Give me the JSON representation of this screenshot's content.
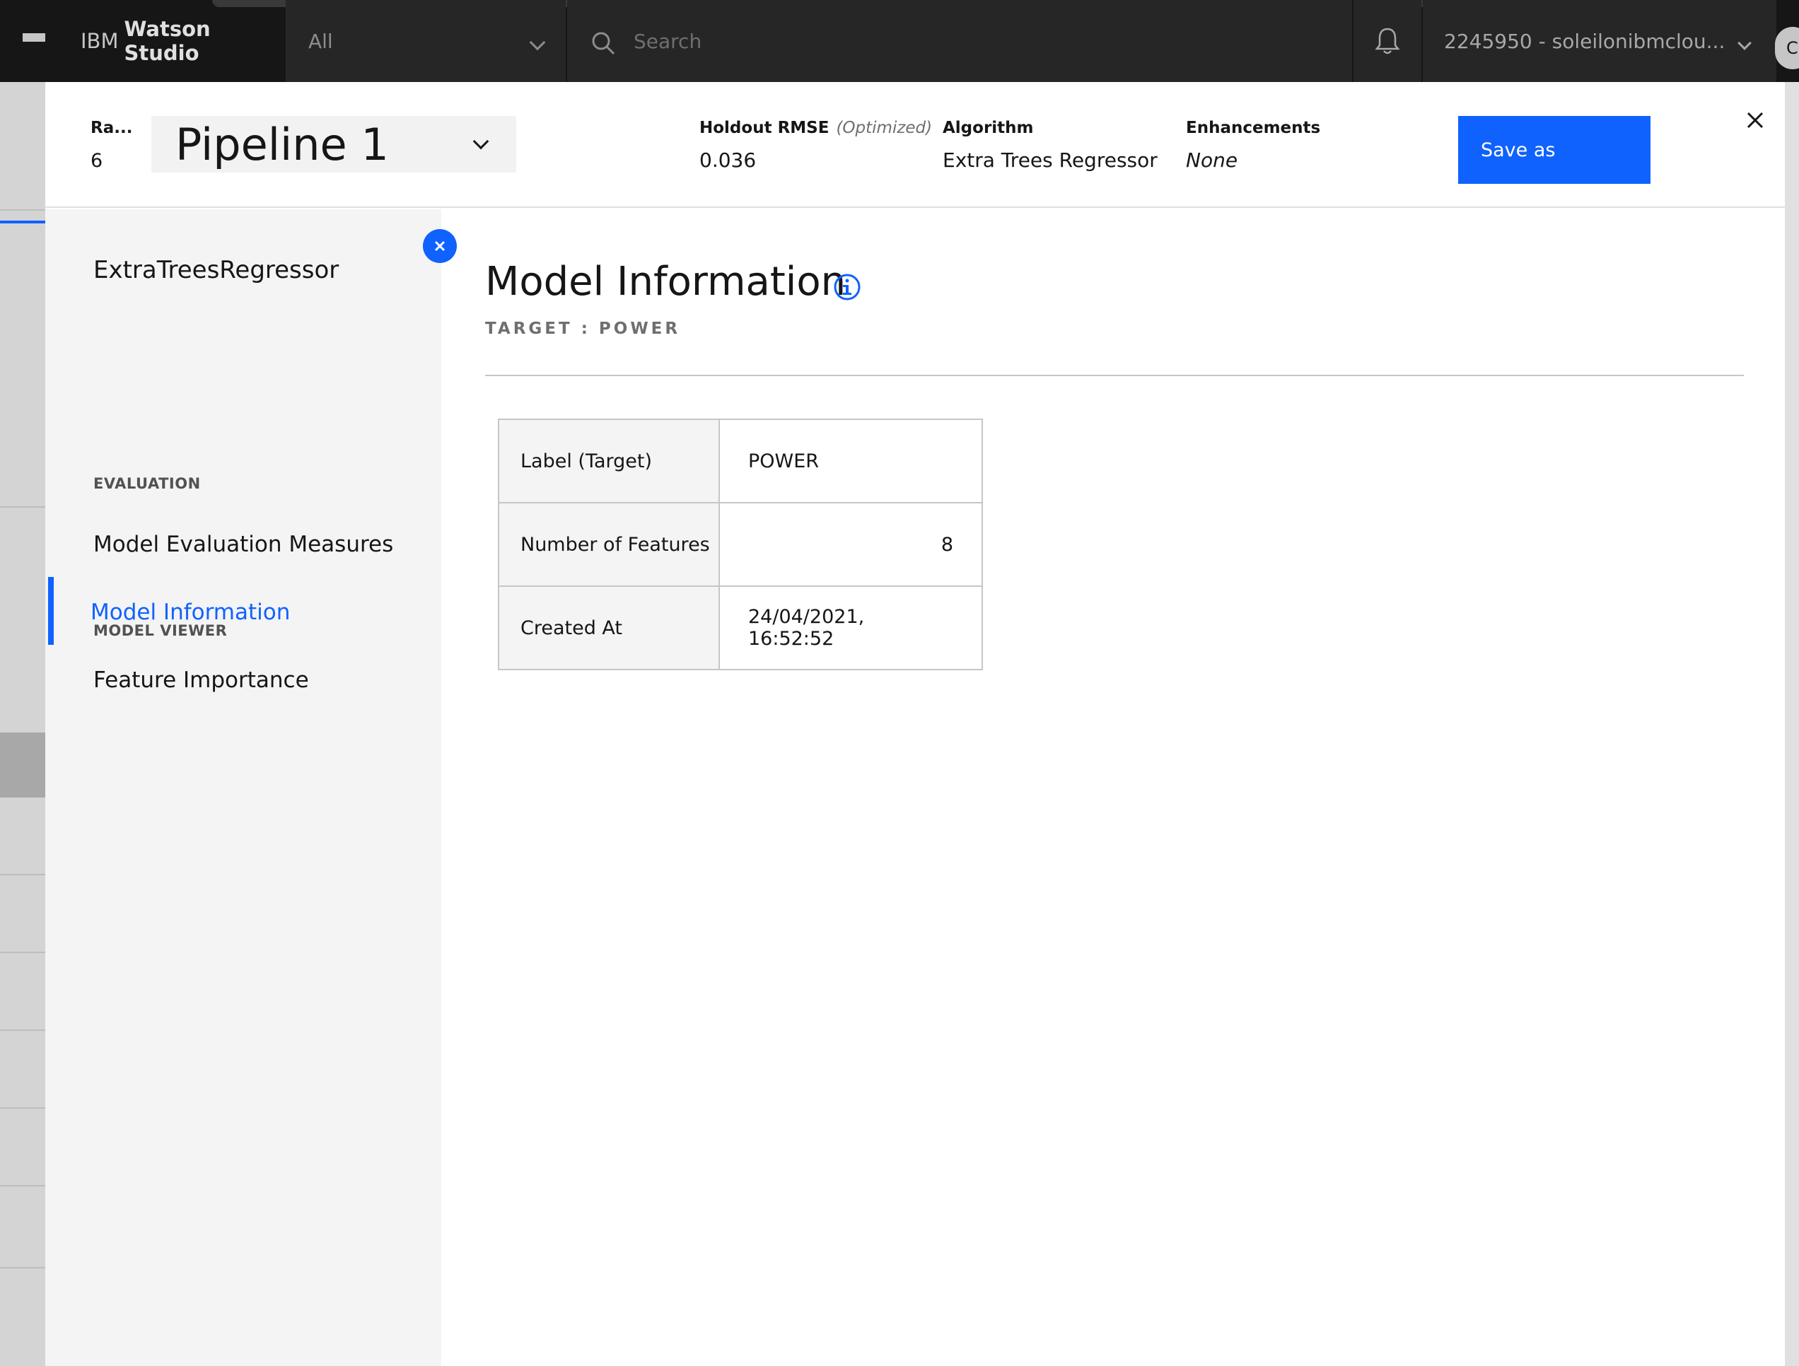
{
  "topbar": {
    "brand_prefix": "IBM",
    "brand_name": "Watson Studio",
    "scope": "All",
    "search_placeholder": "Search",
    "account": "2245950 - soleilonibmclou...",
    "avatar_initial": "C"
  },
  "header": {
    "rank_label": "Ra...",
    "rank_value": "6",
    "pipeline": "Pipeline 1",
    "metric_label": "Holdout RMSE",
    "metric_qualifier": "(Optimized)",
    "metric_value": "0.036",
    "algorithm_label": "Algorithm",
    "algorithm_value": "Extra Trees Regressor",
    "enhancements_label": "Enhancements",
    "enhancements_value": "None",
    "save_label": "Save as"
  },
  "sidebar": {
    "model_name": "ExtraTreesRegressor",
    "evaluation_heading": "EVALUATION",
    "evaluation_item": "Model Evaluation Measures",
    "viewer_heading": "MODEL VIEWER",
    "viewer_items": [
      "Model Information",
      "Feature Importance"
    ]
  },
  "main": {
    "title": "Model Information",
    "target_line": "TARGET : POWER",
    "table": [
      {
        "key": "Label (Target)",
        "value": "POWER"
      },
      {
        "key": "Number of Features",
        "value": "8"
      },
      {
        "key": "Created At",
        "value": "24/04/2021, 16:52:52"
      }
    ]
  },
  "colors": {
    "accent": "#0f62fe",
    "header_bg": "#161616",
    "sidebar_bg": "#f4f4f4"
  }
}
